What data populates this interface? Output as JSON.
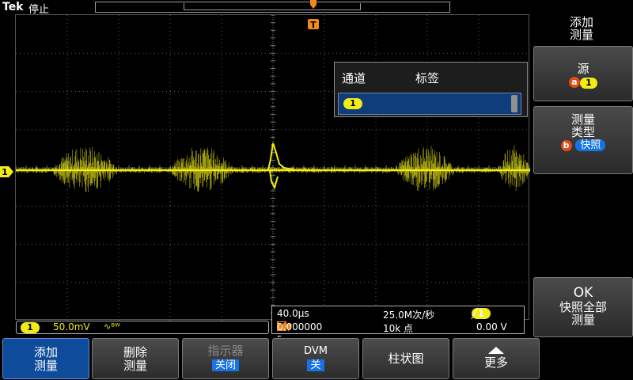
{
  "header": {
    "brand": "Tek",
    "run_state": "停止"
  },
  "markers": {
    "ch1": "1",
    "trigger": "T"
  },
  "popup": {
    "col_channel": "通道",
    "col_label": "标签",
    "row_channel": "1"
  },
  "side_menu": {
    "title_line1": "添加",
    "title_line2": "测量",
    "source_label": "源",
    "source_knob": "a",
    "source_value": "1",
    "type_line1": "测量",
    "type_line2": "类型",
    "type_knob": "b",
    "type_value": "快照",
    "ok_line1": "OK",
    "ok_line2": "快照全部",
    "ok_line3": "测量"
  },
  "status": {
    "ch1_badge": "1",
    "ch1_scale": "50.0mV",
    "bw_icon": "∿ᴮᵂ",
    "timebase": "40.0µs",
    "trig_box": "T",
    "trig_arrow": "→▼",
    "trig_delay": "0.000000 s",
    "sample_rate": "25.0M次/秒",
    "record_length": "10k 点",
    "trig_source": "1",
    "trig_slope": "╱",
    "trig_level": "0.00 V"
  },
  "bottom_menu": {
    "add_line1": "添加",
    "add_line2": "测量",
    "delete_line1": "删除",
    "delete_line2": "测量",
    "indicator_line1": "指示器",
    "indicator_state": "关闭",
    "dvm_line1": "DVM",
    "dvm_state": "关",
    "histogram": "柱状图",
    "more": "更多"
  },
  "colors": {
    "ch1": "#f2ec15",
    "trigger": "#f08a1a",
    "accent": "#1573e3",
    "active_button": "#0e4b9a"
  }
}
